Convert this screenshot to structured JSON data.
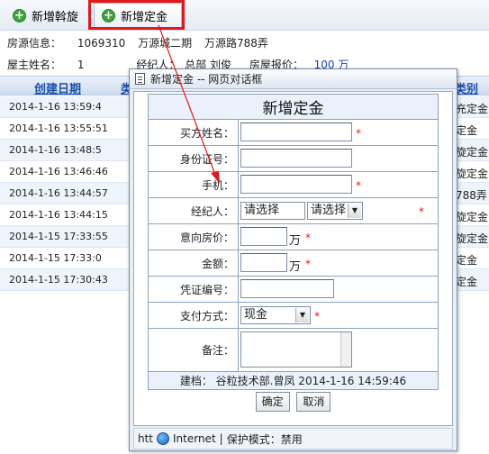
{
  "toolbar": {
    "btn_new_rotation": "新增斡旋",
    "btn_new_deposit": "新增定金"
  },
  "info": {
    "source_label": "房源信息：",
    "source_id": "1069310",
    "source_project": "万源城二期",
    "source_address": "万源路788弄",
    "owner_label": "屋主姓名：",
    "owner_value": "1",
    "agent_label": "经纪人：",
    "agent_value": "总部 刘俊",
    "price_label": "房屋报价：",
    "price_value": "100 万"
  },
  "grid": {
    "col_created": "创建日期",
    "col_second": "类",
    "col_type": "类别",
    "rows": [
      {
        "date": "2014-1-16 13:59:4",
        "type": "充定金"
      },
      {
        "date": "2014-1-16 13:55:51",
        "type": "定金"
      },
      {
        "date": "2014-1-16 13:48:5",
        "type": "旋定金"
      },
      {
        "date": "2014-1-16 13:46:46",
        "type": "旋定金"
      },
      {
        "date": "2014-1-16 13:44:57",
        "type": "788弄"
      },
      {
        "date": "2014-1-16 13:44:15",
        "type": "旋定金"
      },
      {
        "date": "2014-1-15 17:33:55",
        "type": "旋定金"
      },
      {
        "date": "2014-1-15 17:33:0",
        "type": "定金"
      },
      {
        "date": "2014-1-15 17:30:43",
        "type": "定金"
      }
    ]
  },
  "dialog": {
    "window_title": "新增定金 -- 网页对话框",
    "form_title": "新增定金",
    "labels": {
      "buyer_name": "买方姓名：",
      "id_number": "身份证号：",
      "phone": "手机：",
      "agent": "经纪人：",
      "intended_price": "意向房价：",
      "amount": "金额：",
      "voucher_no": "凭证编号：",
      "payment_method": "支付方式：",
      "remarks": "备注："
    },
    "required_mark": "*",
    "agent_select_1": "请选择",
    "agent_select_2": "请选择",
    "unit_wan": "万",
    "payment_value": "现金",
    "created_info": "建档：  谷粒技术部.曾凤  2014-1-16 14:59:46",
    "ok_button": "确定",
    "cancel_button": "取消",
    "status_prefix": "htt",
    "status_zone": "Internet",
    "status_mode": "保护模式：禁用",
    "status_sep": "|"
  }
}
